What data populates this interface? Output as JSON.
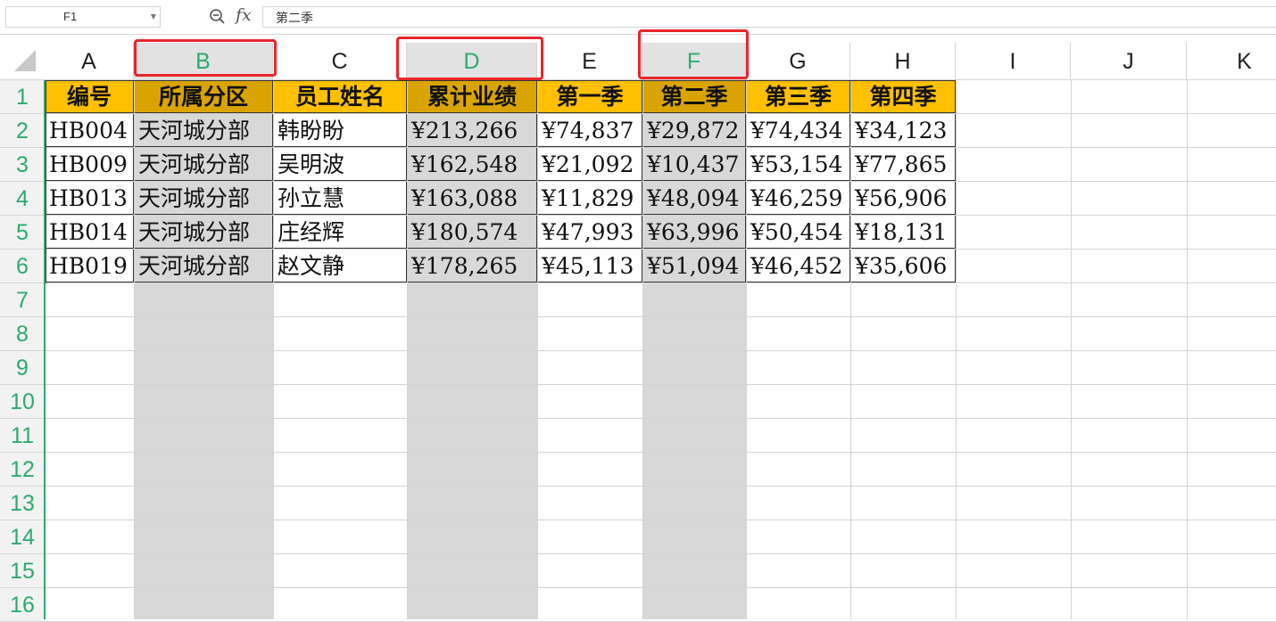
{
  "formula_bar": {
    "name_box": "F1",
    "zoom_icon": "zoom-icon",
    "fx_label": "fx",
    "formula": "第二季"
  },
  "columns": [
    "A",
    "B",
    "C",
    "D",
    "E",
    "F",
    "G",
    "H",
    "I",
    "J",
    "K"
  ],
  "selected_columns": [
    "B",
    "D",
    "F"
  ],
  "rows": [
    "1",
    "2",
    "3",
    "4",
    "5",
    "6",
    "7",
    "8",
    "9",
    "10",
    "11",
    "12",
    "13",
    "14",
    "15",
    "16"
  ],
  "table": {
    "headers": [
      "编号",
      "所属分区",
      "员工姓名",
      "累计业绩",
      "第一季",
      "第二季",
      "第三季",
      "第四季"
    ],
    "data": [
      [
        "HB004",
        "天河城分部",
        "韩盼盼",
        "¥213,266",
        "¥74,837",
        "¥29,872",
        "¥74,434",
        "¥34,123"
      ],
      [
        "HB009",
        "天河城分部",
        "吴明波",
        "¥162,548",
        "¥21,092",
        "¥10,437",
        "¥53,154",
        "¥77,865"
      ],
      [
        "HB013",
        "天河城分部",
        "孙立慧",
        "¥163,088",
        "¥11,829",
        "¥48,094",
        "¥46,259",
        "¥56,906"
      ],
      [
        "HB014",
        "天河城分部",
        "庄经辉",
        "¥180,574",
        "¥47,993",
        "¥63,996",
        "¥50,454",
        "¥18,131"
      ],
      [
        "HB019",
        "天河城分部",
        "赵文静",
        "¥178,265",
        "¥45,113",
        "¥51,094",
        "¥46,452",
        "¥35,606"
      ]
    ]
  },
  "colors": {
    "header_fill": "#ffc000",
    "header_fill_selected": "#d9a400",
    "selection_gray": "#d8d8d8",
    "selected_header_text": "#2aab6e",
    "highlight_box": "#e8262b"
  }
}
